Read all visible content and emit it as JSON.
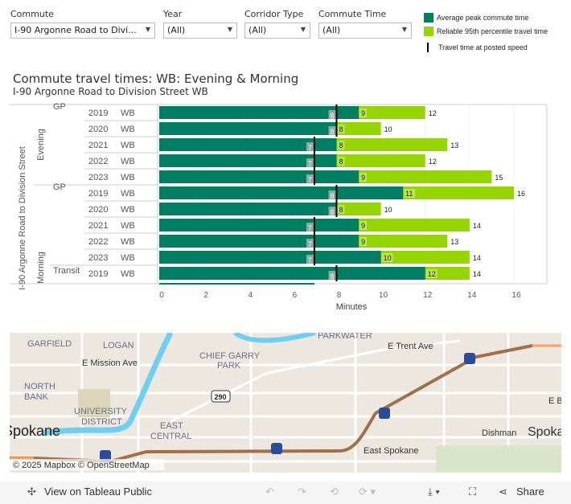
{
  "filters": [
    {
      "label": "Commute",
      "value": "I-90 Argonne Road to Divi..."
    },
    {
      "label": "Year",
      "value": "(All)"
    },
    {
      "label": "Corridor Type",
      "value": "(All)"
    },
    {
      "label": "Commute Time",
      "value": "(All)"
    }
  ],
  "legend": [
    {
      "label": "Average peak commute time",
      "color": "#007e61"
    },
    {
      "label": "Reliable 95th percentile travel time",
      "color": "#96d600"
    },
    {
      "label": "Travel time at posted speed",
      "color": "#000000"
    }
  ],
  "title": "Commute travel times: WB: Evening & Morning",
  "subtitle": "I-90 Argonne Road to Division Street  WB",
  "chart_data": {
    "type": "bar",
    "orientation": "horizontal",
    "row_header": "I-90 Argonne Road to Division Street",
    "xlabel": "Minutes",
    "xlim": [
      0,
      16.5
    ],
    "xticks": [
      0,
      2,
      4,
      6,
      8,
      10,
      12,
      14,
      16
    ],
    "grid": true,
    "rows": [
      {
        "time": "Evening",
        "type": "GP",
        "year": "2019",
        "dir": "WB",
        "posted": 8,
        "average": 9,
        "reliable": 12
      },
      {
        "time": "Evening",
        "type": "",
        "year": "2020",
        "dir": "WB",
        "posted": 8,
        "average": 8,
        "reliable": 10
      },
      {
        "time": "Evening",
        "type": "",
        "year": "2021",
        "dir": "WB",
        "posted": 7,
        "average": 8,
        "reliable": 13
      },
      {
        "time": "Evening",
        "type": "",
        "year": "2022",
        "dir": "WB",
        "posted": 7,
        "average": 8,
        "reliable": 12
      },
      {
        "time": "Evening",
        "type": "",
        "year": "2023",
        "dir": "WB",
        "posted": 7,
        "average": 9,
        "reliable": 15
      },
      {
        "time": "Morning",
        "type": "GP",
        "year": "2019",
        "dir": "WB",
        "posted": 8,
        "average": 11,
        "reliable": 16
      },
      {
        "time": "Morning",
        "type": "",
        "year": "2020",
        "dir": "WB",
        "posted": 8,
        "average": 8,
        "reliable": 10
      },
      {
        "time": "Morning",
        "type": "",
        "year": "2021",
        "dir": "WB",
        "posted": 7,
        "average": 9,
        "reliable": 14
      },
      {
        "time": "Morning",
        "type": "",
        "year": "2022",
        "dir": "WB",
        "posted": 7,
        "average": 9,
        "reliable": 13
      },
      {
        "time": "Morning",
        "type": "",
        "year": "2023",
        "dir": "WB",
        "posted": 7,
        "average": 10,
        "reliable": 14
      },
      {
        "time": "Morning",
        "type": "Transit",
        "year": "2019",
        "dir": "WB",
        "posted": 8,
        "average": 12,
        "reliable": 14
      }
    ],
    "groups": [
      {
        "label": "Evening"
      },
      {
        "label": "Morning"
      }
    ],
    "colors": {
      "average": "#007e61",
      "reliable": "#96d600",
      "posted": "#000000"
    }
  },
  "map": {
    "labels": [
      "GARFIELD",
      "LOGAN",
      "PARKWATER",
      "E Trent Ave",
      "CHIEF GARRY",
      "PARK",
      "E Mission Ave",
      "NORTH",
      "BANK",
      "UNIVERSITY",
      "DISTRICT",
      "EAST",
      "CENTRAL",
      "Spokane",
      "East Spokane",
      "Dishman",
      "Spoka",
      "E B"
    ],
    "route_shield": "290",
    "interstate": "90",
    "attribution": "© 2025 Mapbox © OpenStreetMap"
  },
  "toolbar": {
    "view_label": "View on Tableau Public",
    "share_label": "Share"
  }
}
